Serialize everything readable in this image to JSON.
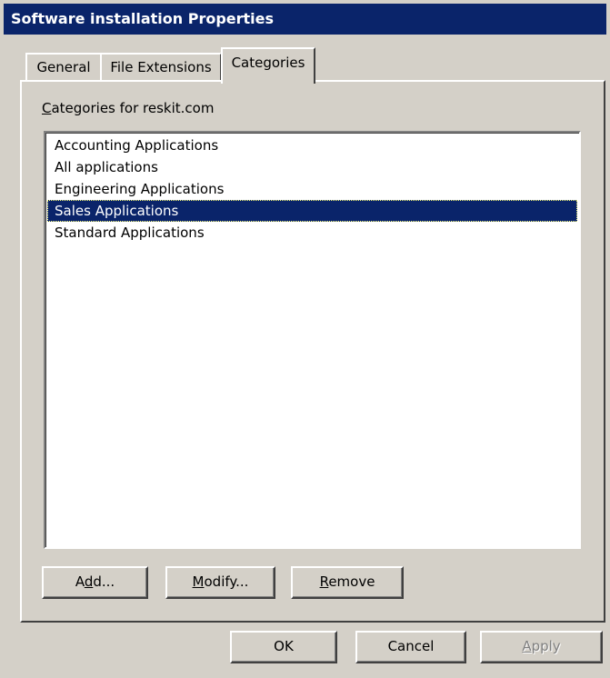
{
  "window": {
    "title": "Software installation Properties"
  },
  "tabs": [
    {
      "label": "General",
      "selected": false
    },
    {
      "label": "File Extensions",
      "selected": false
    },
    {
      "label": "Categories",
      "selected": true
    }
  ],
  "categories_panel": {
    "label_underlined": "C",
    "label_rest": "ategories for reskit.com",
    "items": [
      {
        "label": "Accounting Applications",
        "selected": false
      },
      {
        "label": "All applications",
        "selected": false
      },
      {
        "label": "Engineering Applications",
        "selected": false
      },
      {
        "label": "Sales Applications",
        "selected": true
      },
      {
        "label": "Standard Applications",
        "selected": false
      }
    ],
    "buttons": {
      "add_pre": "A",
      "add_ul": "d",
      "add_post": "d...",
      "modify_ul": "M",
      "modify_post": "odify...",
      "remove_ul": "R",
      "remove_post": "emove"
    }
  },
  "dialog_buttons": {
    "ok": "OK",
    "cancel": "Cancel",
    "apply_ul": "A",
    "apply_post": "pply",
    "apply_enabled": false
  }
}
